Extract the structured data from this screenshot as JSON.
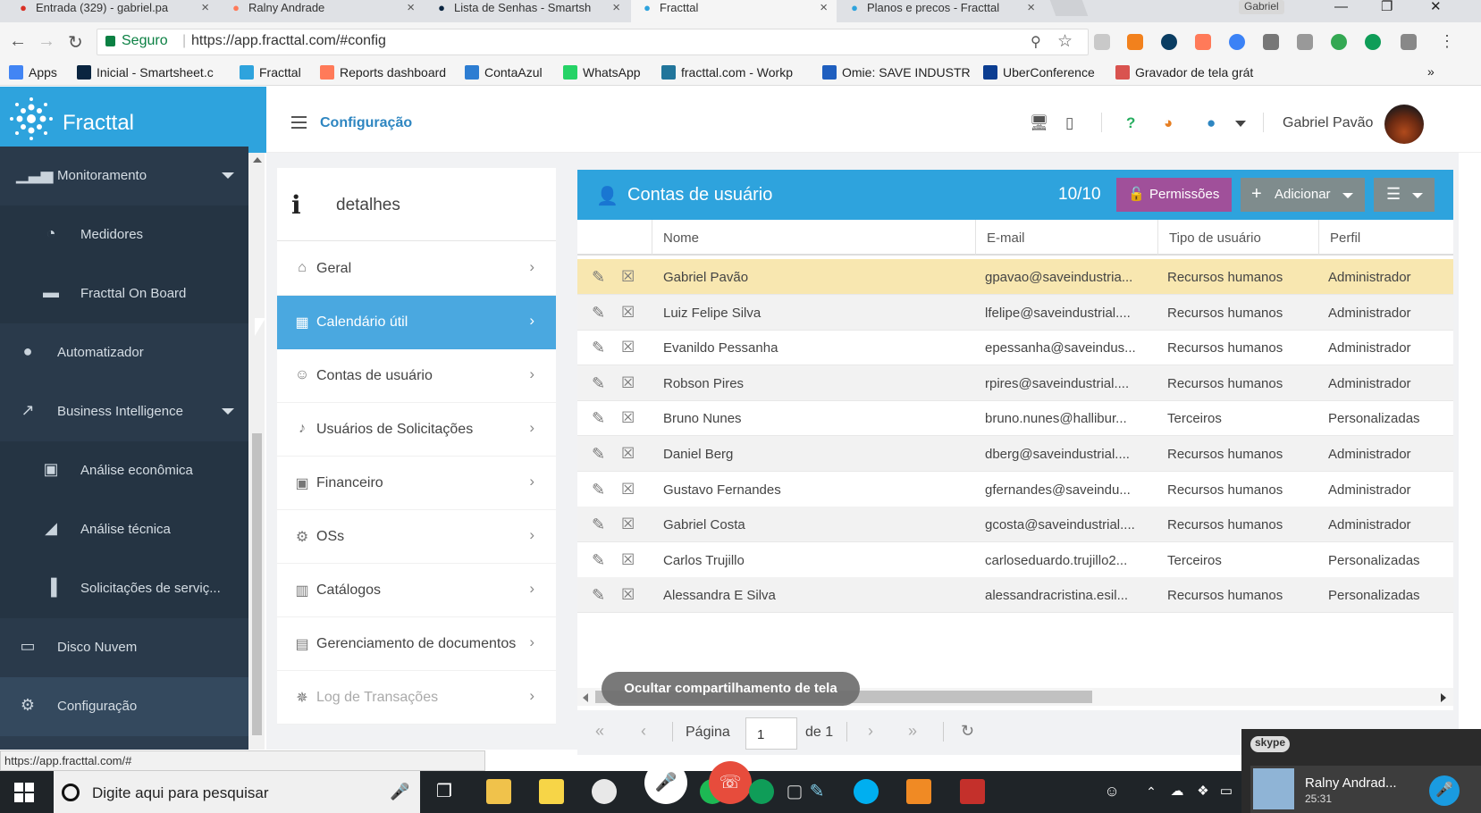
{
  "browser": {
    "tabs": [
      {
        "title": "Entrada (329) - gabriel.pa",
        "icon": "gmail-icon",
        "color": "#d93025"
      },
      {
        "title": "Ralny Andrade",
        "icon": "hubspot-icon",
        "color": "#ff7a59"
      },
      {
        "title": "Lista de Senhas - Smartsh",
        "icon": "smartsheet-icon",
        "color": "#0a2540"
      },
      {
        "title": "Fracttal",
        "icon": "fracttal-icon",
        "color": "#2ea3dd"
      },
      {
        "title": "Planos e precos - Fracttal",
        "icon": "fracttal-icon",
        "color": "#2ea3dd"
      }
    ],
    "profile_label": "Gabriel",
    "secure_label": "Seguro",
    "url": "https://app.fracttal.com/#config",
    "bookmarks": [
      {
        "label": "Apps",
        "icon": "apps-grid-icon",
        "color": "#4285f4"
      },
      {
        "label": "Inicial - Smartsheet.c",
        "icon": "smartsheet-icon",
        "color": "#0a2540"
      },
      {
        "label": "Fracttal",
        "icon": "fracttal-icon",
        "color": "#2ea3dd"
      },
      {
        "label": "Reports dashboard",
        "icon": "hubspot-icon",
        "color": "#ff7a59"
      },
      {
        "label": "ContaAzul",
        "icon": "contaazul-icon",
        "color": "#2d7dd2"
      },
      {
        "label": "WhatsApp",
        "icon": "whatsapp-icon",
        "color": "#25d366"
      },
      {
        "label": "fracttal.com - Workp",
        "icon": "wordpress-icon",
        "color": "#21759b"
      },
      {
        "label": "Omie: SAVE INDUSTR",
        "icon": "omie-icon",
        "color": "#1f5fbf"
      },
      {
        "label": "UberConference",
        "icon": "uberconference-icon",
        "color": "#0b3d91"
      },
      {
        "label": "Gravador de tela grát",
        "icon": "recorder-icon",
        "color": "#d9534f"
      }
    ],
    "status_url": "https://app.fracttal.com/#"
  },
  "app": {
    "name": "Fracttal",
    "brand_color": "#2ea3dd",
    "breadcrumb": "Configuração",
    "user_name": "Gabriel Pavão"
  },
  "sidebar": {
    "items": [
      {
        "label": "Monitoramento",
        "icon": "signal-bars-icon",
        "expandable": true
      },
      {
        "label": "Medidores",
        "icon": "gauge-icon",
        "sub": true
      },
      {
        "label": "Fracttal On Board",
        "icon": "car-icon",
        "sub": true
      },
      {
        "label": "Automatizador",
        "icon": "chat-bubble-icon"
      },
      {
        "label": "Business Intelligence",
        "icon": "line-chart-icon",
        "expandable": true
      },
      {
        "label": "Análise econômica",
        "icon": "money-icon",
        "sub": true
      },
      {
        "label": "Análise técnica",
        "icon": "area-chart-icon",
        "sub": true
      },
      {
        "label": "Solicitações de serviç...",
        "icon": "bar-chart-icon",
        "sub": true
      },
      {
        "label": "Disco Nuvem",
        "icon": "hard-drive-icon"
      },
      {
        "label": "Configuração",
        "icon": "gear-icon"
      }
    ]
  },
  "details": {
    "title": "detalhes",
    "menu": [
      {
        "label": "Geral",
        "icon": "home-icon"
      },
      {
        "label": "Calendário útil",
        "icon": "calendar-icon",
        "active": true
      },
      {
        "label": "Contas de usuário",
        "icon": "user-plus-icon"
      },
      {
        "label": "Usuários de Solicitações",
        "icon": "bell-icon"
      },
      {
        "label": "Financeiro",
        "icon": "money-icon"
      },
      {
        "label": "OSs",
        "icon": "gears-icon"
      },
      {
        "label": "Catálogos",
        "icon": "map-icon"
      },
      {
        "label": "Gerenciamento de documentos",
        "icon": "document-icon"
      },
      {
        "label": "Log de Transações",
        "icon": "bug-icon",
        "disabled": true
      }
    ]
  },
  "accounts": {
    "title": "Contas de usuário",
    "count": "10/10",
    "permissions_label": "Permissões",
    "add_label": "Adicionar",
    "columns": [
      "Nome",
      "E-mail",
      "Tipo de usuário",
      "Perfil"
    ],
    "rows": [
      [
        "Gabriel Pavão",
        "gpavao@saveindustria...",
        "Recursos humanos",
        "Administrador"
      ],
      [
        "Luiz Felipe Silva",
        "lfelipe@saveindustrial....",
        "Recursos humanos",
        "Administrador"
      ],
      [
        "Evanildo Pessanha",
        "epessanha@saveindus...",
        "Recursos humanos",
        "Administrador"
      ],
      [
        "Robson Pires",
        "rpires@saveindustrial....",
        "Recursos humanos",
        "Administrador"
      ],
      [
        "Bruno Nunes",
        "bruno.nunes@hallibur...",
        "Terceiros",
        "Personalizadas"
      ],
      [
        "Daniel Berg",
        "dberg@saveindustrial....",
        "Recursos humanos",
        "Administrador"
      ],
      [
        "Gustavo Fernandes",
        "gfernandes@saveindu...",
        "Recursos humanos",
        "Administrador"
      ],
      [
        "Gabriel Costa",
        "gcosta@saveindustrial....",
        "Recursos humanos",
        "Administrador"
      ],
      [
        "Carlos Trujillo",
        "carloseduardo.trujillo2...",
        "Terceiros",
        "Personalizadas"
      ],
      [
        "Alessandra E Silva",
        "alessandracristina.esil...",
        "Recursos humanos",
        "Personalizadas"
      ]
    ],
    "selected_row": 0
  },
  "pager": {
    "page_label": "Página",
    "page_value": "1",
    "of_label": "de 1"
  },
  "screen_share": {
    "label": "Ocultar compartilhamento de tela"
  },
  "skype": {
    "logo": "skype",
    "caller": "Ralny Andrad...",
    "duration": "25:31"
  },
  "taskbar": {
    "search_placeholder": "Digite aqui para pesquisar"
  }
}
